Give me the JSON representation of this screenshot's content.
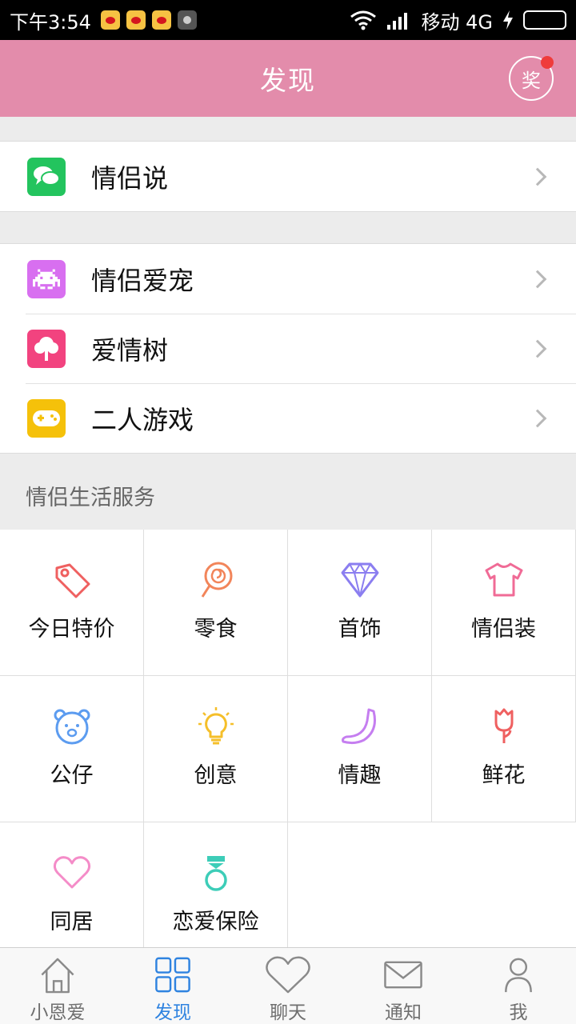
{
  "status_bar": {
    "time": "下午3:54",
    "carrier": "移动 4G"
  },
  "header": {
    "title": "发现",
    "award_label": "奖"
  },
  "group1": [
    {
      "label": "情侣说",
      "icon": "chat-bubbles-icon",
      "color": "#23c45e"
    }
  ],
  "group2": [
    {
      "label": "情侣爱宠",
      "icon": "space-invader-icon",
      "color": "#d86ff0"
    },
    {
      "label": "爱情树",
      "icon": "tree-icon",
      "color": "#f2437f"
    },
    {
      "label": "二人游戏",
      "icon": "gamepad-icon",
      "color": "#f5c10a"
    }
  ],
  "services": {
    "title": "情侣生活服务",
    "items": [
      {
        "label": "今日特价",
        "icon": "price-tag-icon",
        "color": "#ef6060"
      },
      {
        "label": "零食",
        "icon": "lollipop-icon",
        "color": "#f2855a"
      },
      {
        "label": "首饰",
        "icon": "diamond-icon",
        "color": "#8b7ef0"
      },
      {
        "label": "情侣装",
        "icon": "t-shirt-icon",
        "color": "#f06b96"
      },
      {
        "label": "公仔",
        "icon": "teddy-bear-icon",
        "color": "#5c9cf0"
      },
      {
        "label": "创意",
        "icon": "light-bulb-icon",
        "color": "#f5bf2a"
      },
      {
        "label": "情趣",
        "icon": "banana-icon",
        "color": "#c57ef0"
      },
      {
        "label": "鲜花",
        "icon": "rose-icon",
        "color": "#ef6060"
      },
      {
        "label": "同居",
        "icon": "heart-icon",
        "color": "#f48cc8"
      },
      {
        "label": "恋爱保险",
        "icon": "diamond-ring-icon",
        "color": "#3dcdb8"
      }
    ]
  },
  "tabbar": [
    {
      "label": "小恩爱",
      "icon": "home-icon",
      "active": false
    },
    {
      "label": "发现",
      "icon": "grid-icon",
      "active": true
    },
    {
      "label": "聊天",
      "icon": "heart-outline-icon",
      "active": false
    },
    {
      "label": "通知",
      "icon": "envelope-icon",
      "active": false
    },
    {
      "label": "我",
      "icon": "person-icon",
      "active": false
    }
  ]
}
